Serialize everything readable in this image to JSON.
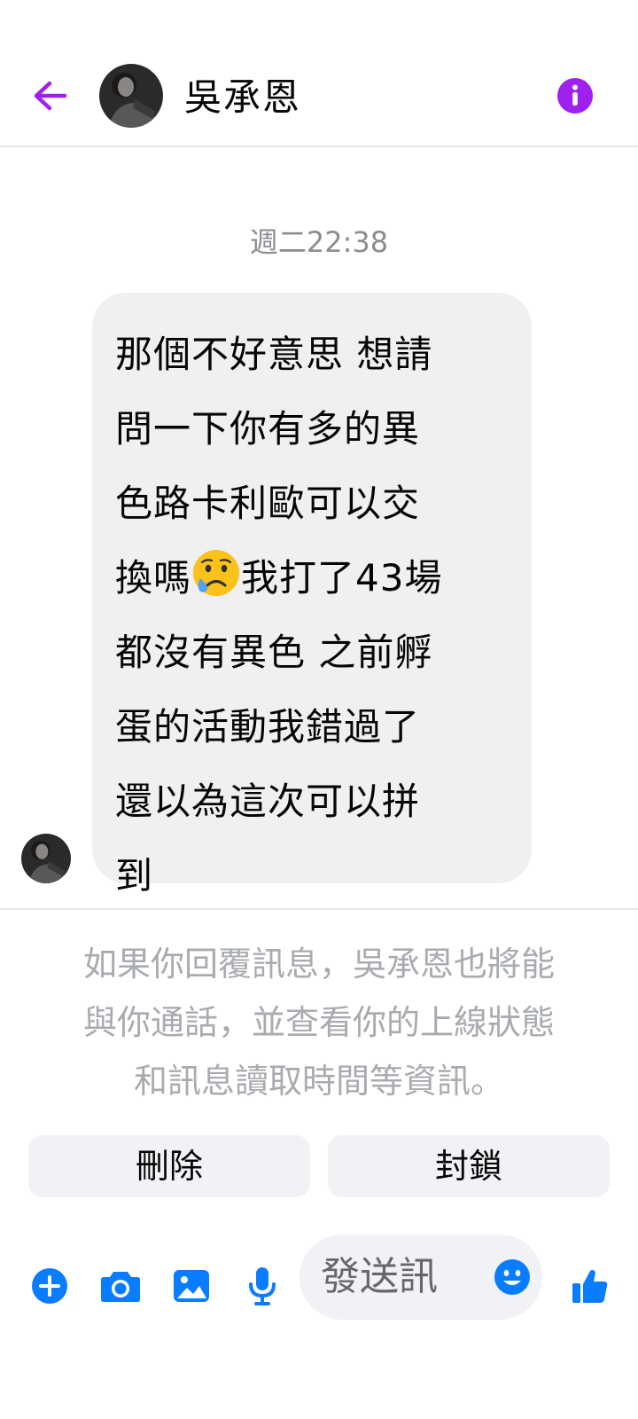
{
  "header": {
    "back_icon": "arrow-left-icon",
    "contact_name": "吳承恩",
    "info_icon": "info-icon",
    "accent_color": "#a020f0"
  },
  "conversation": {
    "timestamp": "週二22:38",
    "message_lines": [
      "那個不好意思 想請",
      "問一下你有多的異",
      "色路卡利歐可以交",
      "換嗎",
      "我打了43場",
      "都沒有異色 之前孵",
      "蛋的活動我錯過了",
      "還以為這次可以拼",
      "到"
    ],
    "emoji": "crying-face-emoji"
  },
  "request_notice": {
    "lines": [
      "如果你回覆訊息，吳承恩也將能",
      "與你通話，並查看你的上線狀態",
      "和訊息讀取時間等資訊。"
    ]
  },
  "actions": {
    "delete_label": "刪除",
    "block_label": "封鎖"
  },
  "composer": {
    "placeholder": "發送訊",
    "icons": [
      "plus-icon",
      "camera-icon",
      "image-icon",
      "microphone-icon",
      "emoji-icon",
      "thumbs-up-icon"
    ],
    "icon_color": "#0a7cff"
  }
}
